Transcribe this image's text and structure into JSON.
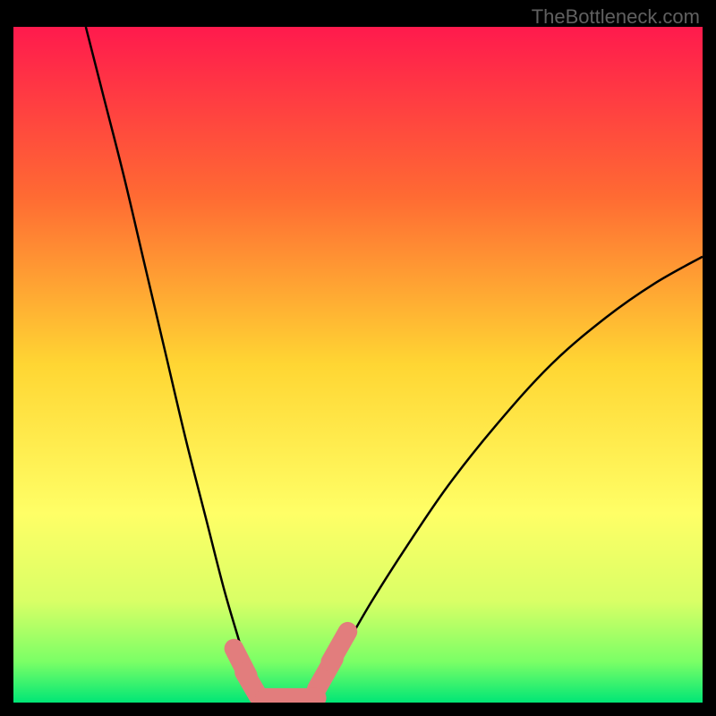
{
  "watermark": "TheBottleneck.com",
  "chart_data": {
    "type": "line",
    "title": "",
    "xlabel": "",
    "ylabel": "",
    "xlim": [
      0,
      100
    ],
    "ylim": [
      0,
      100
    ],
    "background_gradient": {
      "stops": [
        {
          "offset": 0,
          "color": "#ff1a4d"
        },
        {
          "offset": 25,
          "color": "#ff6a33"
        },
        {
          "offset": 50,
          "color": "#ffd633"
        },
        {
          "offset": 72,
          "color": "#ffff66"
        },
        {
          "offset": 85,
          "color": "#d9ff66"
        },
        {
          "offset": 94,
          "color": "#7aff66"
        },
        {
          "offset": 100,
          "color": "#00e676"
        }
      ]
    },
    "series": [
      {
        "name": "left_curve",
        "stroke": "#000000",
        "points": [
          {
            "x": 10.5,
            "y": 100
          },
          {
            "x": 13,
            "y": 90
          },
          {
            "x": 16,
            "y": 78
          },
          {
            "x": 19,
            "y": 65
          },
          {
            "x": 22,
            "y": 52
          },
          {
            "x": 25,
            "y": 39
          },
          {
            "x": 28,
            "y": 27
          },
          {
            "x": 30.5,
            "y": 17
          },
          {
            "x": 32.5,
            "y": 10
          },
          {
            "x": 34,
            "y": 5
          },
          {
            "x": 35.5,
            "y": 2
          },
          {
            "x": 37,
            "y": 0.5
          }
        ]
      },
      {
        "name": "right_curve",
        "stroke": "#000000",
        "points": [
          {
            "x": 43,
            "y": 0.5
          },
          {
            "x": 45,
            "y": 3
          },
          {
            "x": 48,
            "y": 8
          },
          {
            "x": 52,
            "y": 15
          },
          {
            "x": 57,
            "y": 23
          },
          {
            "x": 63,
            "y": 32
          },
          {
            "x": 70,
            "y": 41
          },
          {
            "x": 78,
            "y": 50
          },
          {
            "x": 86,
            "y": 57
          },
          {
            "x": 93,
            "y": 62
          },
          {
            "x": 100,
            "y": 66
          }
        ]
      }
    ],
    "markers": [
      {
        "type": "capsule",
        "color": "#e27d7d",
        "x1": 32.0,
        "y1": 8.0,
        "x2": 34.0,
        "y2": 4.0,
        "r": 1.4
      },
      {
        "type": "capsule",
        "color": "#e27d7d",
        "x1": 33.5,
        "y1": 4.5,
        "x2": 35.5,
        "y2": 1.0,
        "r": 1.4
      },
      {
        "type": "capsule",
        "color": "#e27d7d",
        "x1": 44.0,
        "y1": 2.0,
        "x2": 46.5,
        "y2": 6.5,
        "r": 1.4
      },
      {
        "type": "capsule",
        "color": "#e27d7d",
        "x1": 46.0,
        "y1": 6.0,
        "x2": 48.5,
        "y2": 10.5,
        "r": 1.4
      },
      {
        "type": "capsule",
        "color": "#e27d7d",
        "x1": 36.5,
        "y1": 0.7,
        "x2": 44.0,
        "y2": 0.7,
        "r": 1.4
      }
    ]
  }
}
